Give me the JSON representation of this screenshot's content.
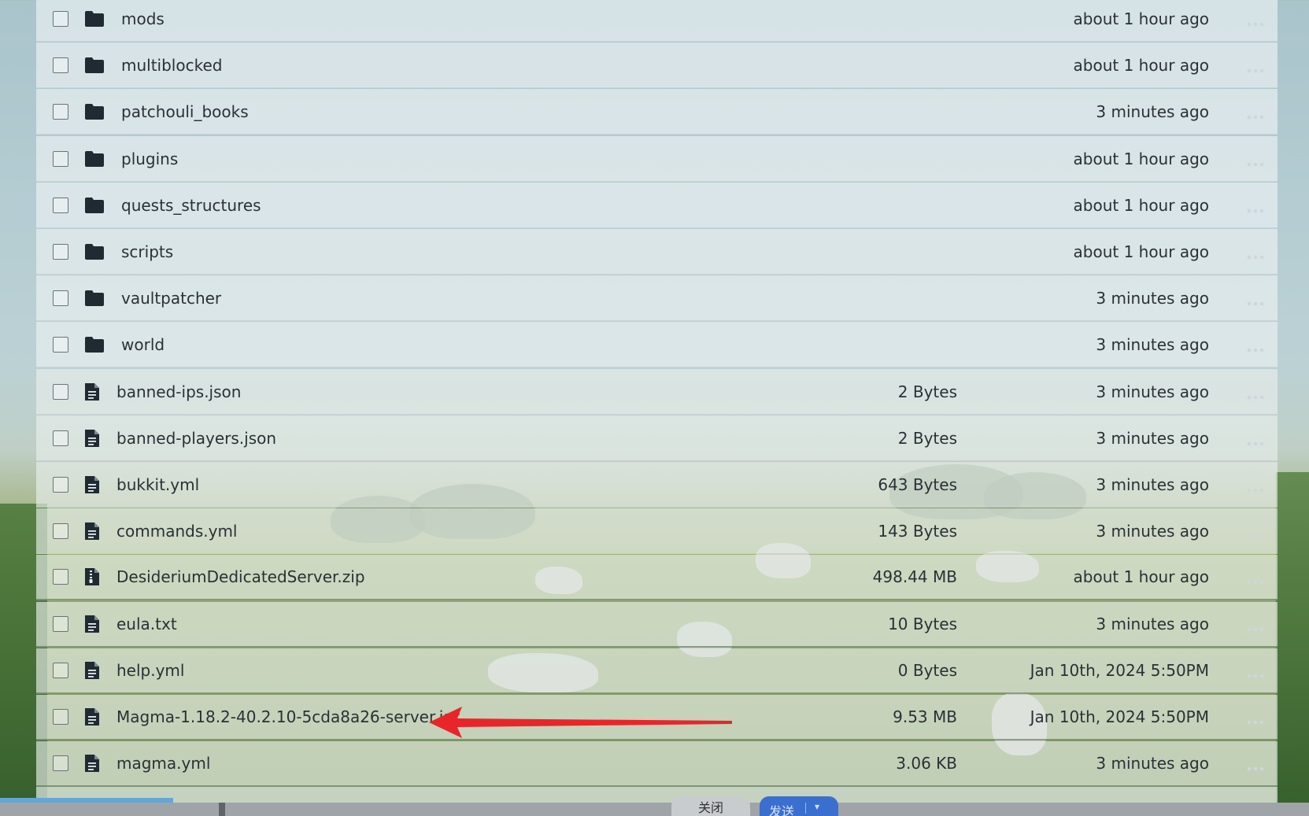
{
  "files": [
    {
      "name": "mods",
      "type": "folder",
      "size": "",
      "modified": "about 1 hour ago"
    },
    {
      "name": "multiblocked",
      "type": "folder",
      "size": "",
      "modified": "about 1 hour ago"
    },
    {
      "name": "patchouli_books",
      "type": "folder",
      "size": "",
      "modified": "3 minutes ago"
    },
    {
      "name": "plugins",
      "type": "folder",
      "size": "",
      "modified": "about 1 hour ago"
    },
    {
      "name": "quests_structures",
      "type": "folder",
      "size": "",
      "modified": "about 1 hour ago"
    },
    {
      "name": "scripts",
      "type": "folder",
      "size": "",
      "modified": "about 1 hour ago"
    },
    {
      "name": "vaultpatcher",
      "type": "folder",
      "size": "",
      "modified": "3 minutes ago"
    },
    {
      "name": "world",
      "type": "folder",
      "size": "",
      "modified": "3 minutes ago"
    },
    {
      "name": "banned-ips.json",
      "type": "file",
      "size": "2 Bytes",
      "modified": "3 minutes ago"
    },
    {
      "name": "banned-players.json",
      "type": "file",
      "size": "2 Bytes",
      "modified": "3 minutes ago"
    },
    {
      "name": "bukkit.yml",
      "type": "file",
      "size": "643 Bytes",
      "modified": "3 minutes ago"
    },
    {
      "name": "commands.yml",
      "type": "file",
      "size": "143 Bytes",
      "modified": "3 minutes ago"
    },
    {
      "name": "DesideriumDedicatedServer.zip",
      "type": "archive",
      "size": "498.44 MB",
      "modified": "about 1 hour ago"
    },
    {
      "name": "eula.txt",
      "type": "file",
      "size": "10 Bytes",
      "modified": "3 minutes ago"
    },
    {
      "name": "help.yml",
      "type": "file",
      "size": "0 Bytes",
      "modified": "Jan 10th, 2024 5:50PM"
    },
    {
      "name": "Magma-1.18.2-40.2.10-5cda8a26-server.jar",
      "type": "file",
      "size": "9.53 MB",
      "modified": "Jan 10th, 2024 5:50PM"
    },
    {
      "name": "magma.yml",
      "type": "file",
      "size": "3.06 KB",
      "modified": "3 minutes ago"
    }
  ],
  "annotation": {
    "color": "#e8262a",
    "target": "Magma-1.18.2-40.2.10-5cda8a26-server.jar"
  },
  "bottom_bar": {
    "close_label": "关闭",
    "send_label": "发送",
    "send_caret": "▾"
  },
  "icons": {
    "folder": "folder-icon",
    "file": "file-icon",
    "archive": "archive-file-icon",
    "more": "more-options-icon"
  }
}
